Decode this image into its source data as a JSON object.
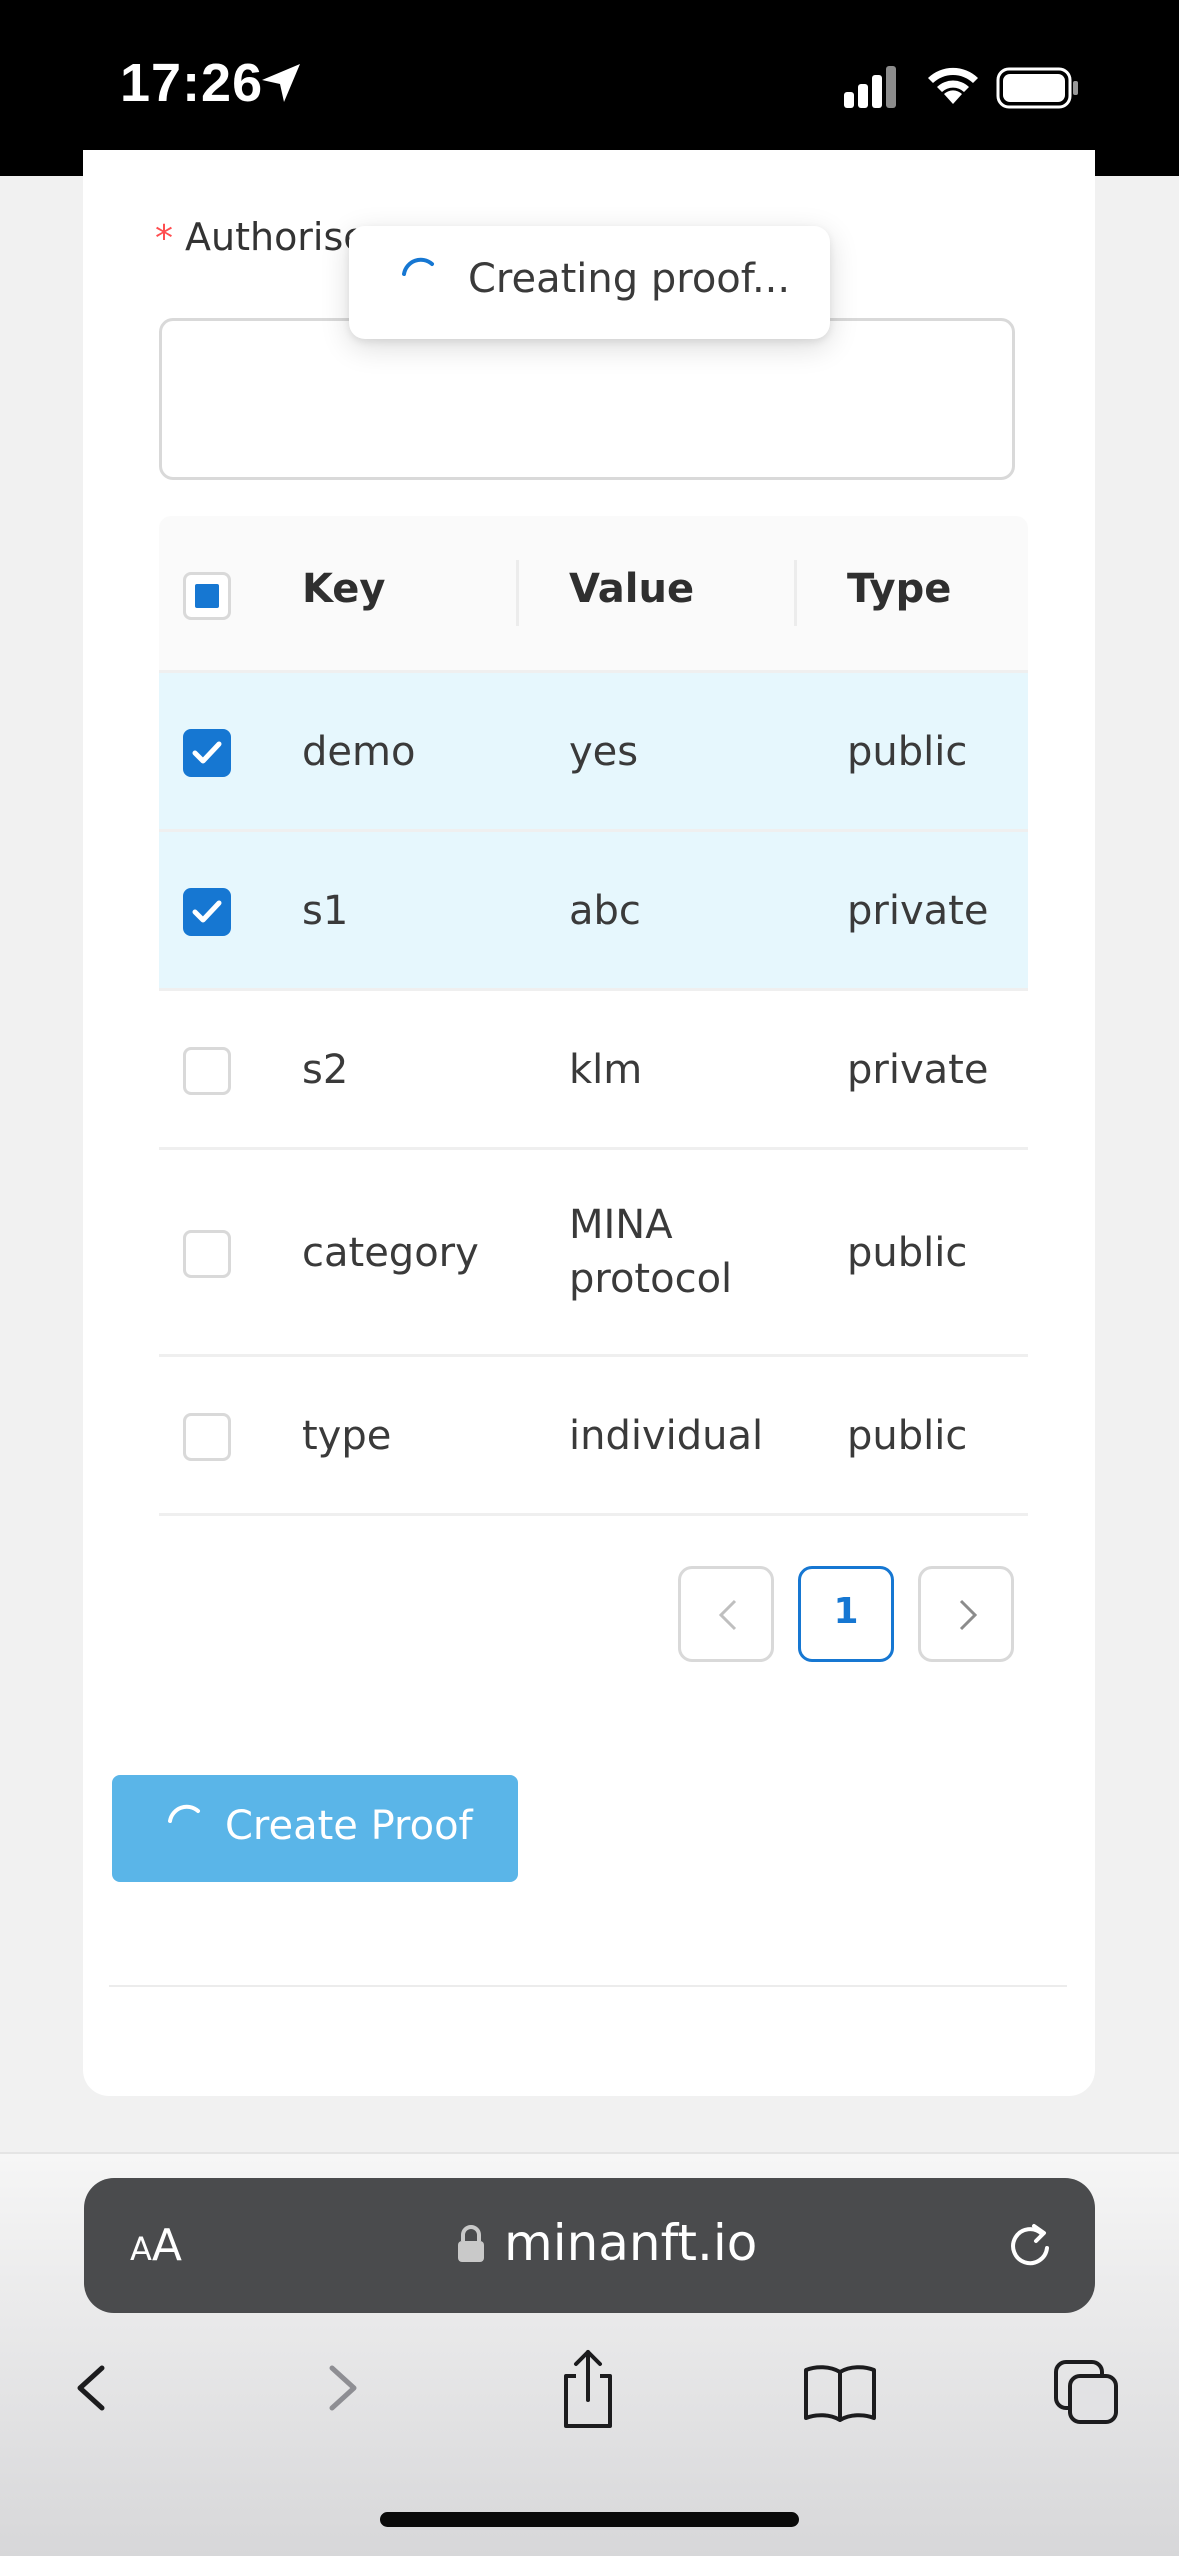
{
  "status_bar": {
    "time": "17:26"
  },
  "form": {
    "required_mark": "*",
    "label": "Authorise"
  },
  "toast": {
    "text": "Creating proof..."
  },
  "table": {
    "headers": {
      "key": "Key",
      "value": "Value",
      "type": "Type"
    },
    "rows": [
      {
        "key": "demo",
        "value": "yes",
        "type": "public",
        "checked": true
      },
      {
        "key": "s1",
        "value": "abc",
        "type": "private",
        "checked": true
      },
      {
        "key": "s2",
        "value": "klm",
        "type": "private",
        "checked": false
      },
      {
        "key": "category",
        "value_line1": "MINA",
        "value_line2": "protocol",
        "type": "public",
        "checked": false
      },
      {
        "key": "type",
        "value": "individual",
        "type": "public",
        "checked": false
      }
    ]
  },
  "pagination": {
    "current_page": "1"
  },
  "actions": {
    "create_proof": "Create Proof"
  },
  "browser": {
    "text_size_small": "A",
    "text_size_large": "A",
    "url": "minanft.io"
  },
  "colors": {
    "accent": "#1677d2",
    "button": "#5ab5e8",
    "selected_row": "#e6f7fd"
  }
}
